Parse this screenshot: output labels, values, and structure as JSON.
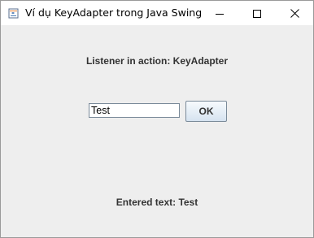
{
  "window": {
    "title": "Ví dụ KeyAdapter trong Java Swing",
    "icon": "java-app-icon",
    "controls": {
      "minimize": "minimize-icon",
      "maximize": "maximize-icon",
      "close": "close-icon"
    }
  },
  "main": {
    "heading": "Listener in action: KeyAdapter",
    "text_field_value": "Test",
    "ok_label": "OK",
    "result": "Entered text: Test"
  }
}
